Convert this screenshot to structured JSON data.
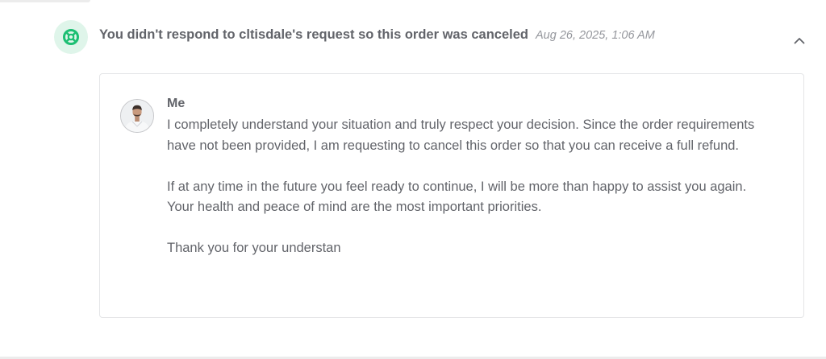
{
  "event": {
    "icon": "lifebuoy-icon",
    "title": "You didn't respond to cltisdale's request so this order was canceled",
    "timestamp": "Aug 26, 2025, 1:06 AM",
    "toggle_icon": "chevron-up-icon"
  },
  "message": {
    "sender": "Me",
    "avatar": "user-avatar",
    "paragraphs": [
      "I completely understand your situation and truly respect your decision. Since the order requirements have not been provided, I am requesting to cancel this order so that you can receive a full refund.",
      "If at any time in the future you feel ready to continue, I will be more than happy to assist you again. Your health and peace of mind are the most important priorities.",
      "Thank you for your understan"
    ]
  },
  "colors": {
    "accent_green": "#1dbf73",
    "icon_bg": "#dff5ea",
    "text": "#62646a",
    "muted_text": "#95979d",
    "border": "#e4e5e7"
  }
}
